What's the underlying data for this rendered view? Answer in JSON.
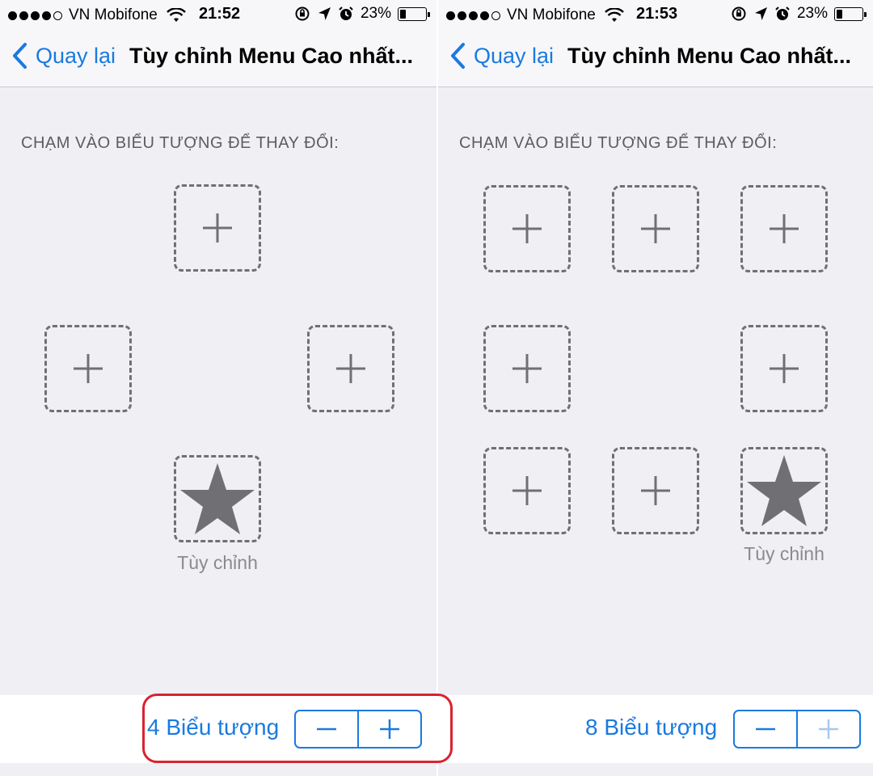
{
  "colors": {
    "accent": "#1a7ae0",
    "highlight": "#d9232e",
    "background": "#efeff4",
    "slot_border": "#6f6f74",
    "icon": "#6f6f74"
  },
  "left": {
    "status": {
      "carrier": "VN Mobifone",
      "time": "21:52",
      "battery": "23%",
      "battery_level": 0.23
    },
    "nav": {
      "back_label": "Quay lại",
      "title": "Tùy chỉnh Menu Cao nhất..."
    },
    "section_header": "CHẠM VÀO BIỂU TƯỢNG ĐỂ THAY ĐỔI:",
    "slots": [
      {
        "icon": "plus-icon"
      },
      {
        "icon": "plus-icon"
      },
      {
        "icon": "plus-icon"
      },
      {
        "icon": "star-icon",
        "label": "Tùy chỉnh"
      }
    ],
    "count_label": "4 Biểu tượng",
    "stepper": {
      "minus_enabled": true,
      "plus_enabled": true
    }
  },
  "right": {
    "status": {
      "carrier": "VN Mobifone",
      "time": "21:53",
      "battery": "23%",
      "battery_level": 0.23
    },
    "nav": {
      "back_label": "Quay lại",
      "title": "Tùy chỉnh Menu Cao nhất..."
    },
    "section_header": "CHẠM VÀO BIỂU TƯỢNG ĐỂ THAY ĐỔI:",
    "slots": [
      {
        "icon": "plus-icon"
      },
      {
        "icon": "plus-icon"
      },
      {
        "icon": "plus-icon"
      },
      {
        "icon": "plus-icon"
      },
      {
        "icon": "plus-icon"
      },
      {
        "icon": "plus-icon"
      },
      {
        "icon": "plus-icon"
      },
      {
        "icon": "star-icon",
        "label": "Tùy chỉnh"
      }
    ],
    "count_label": "8 Biểu tượng",
    "stepper": {
      "minus_enabled": true,
      "plus_enabled": false
    }
  }
}
